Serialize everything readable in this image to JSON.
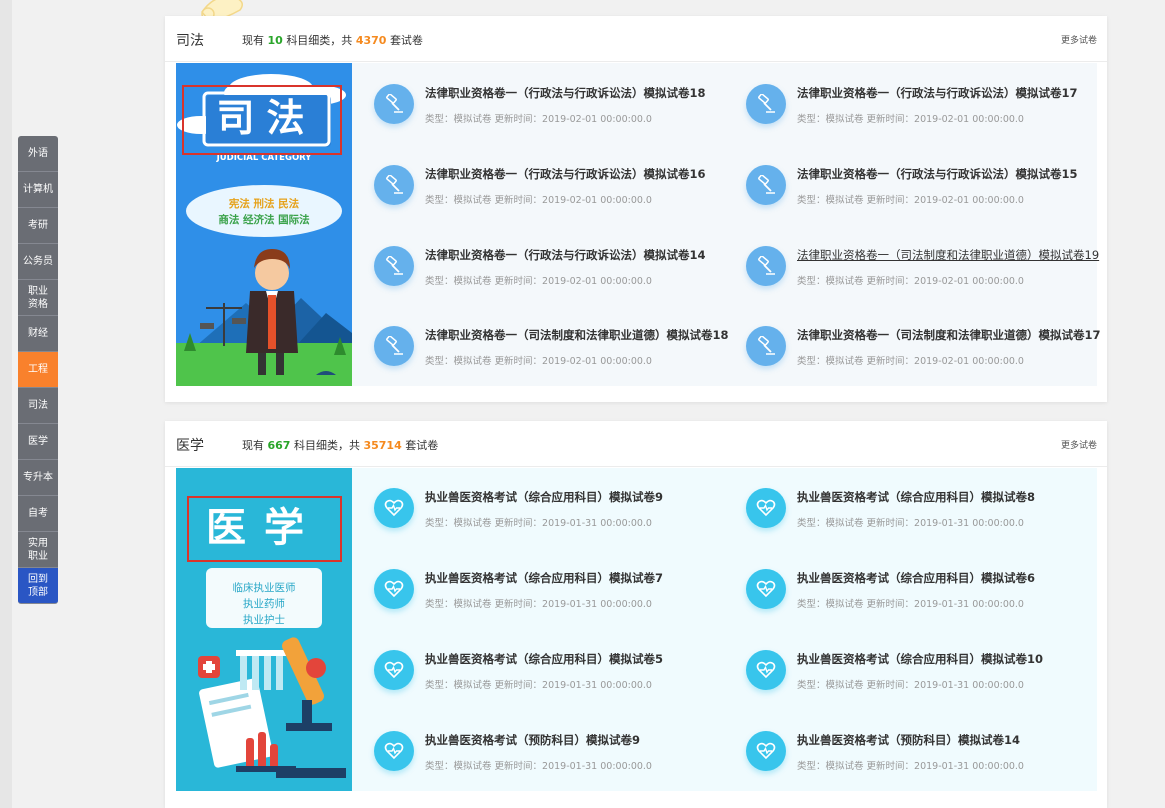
{
  "sidenav": [
    {
      "label": "外语"
    },
    {
      "label": "计算机"
    },
    {
      "label": "考研"
    },
    {
      "label": "公务员"
    },
    {
      "label": "职业资格"
    },
    {
      "label": "财经"
    },
    {
      "label": "工程"
    },
    {
      "label": "司法"
    },
    {
      "label": "医学"
    },
    {
      "label": "专升本"
    },
    {
      "label": "自考"
    },
    {
      "label": "实用职业"
    },
    {
      "label": "回到顶部"
    }
  ],
  "sections": [
    {
      "title": "司法",
      "stats": {
        "prefix": "现有",
        "subjects": "10",
        "mid": "科目细类，共",
        "papers": "4370",
        "suffix": "套试卷"
      },
      "more": "更多试卷",
      "banner": {
        "title": "司法",
        "subtitle": "JUDICIAL CATEGORY",
        "line1": "宪法  刑法  民法",
        "line2": "商法 经济法 国际法"
      },
      "papers": [
        {
          "title": "法律职业资格卷一（行政法与行政诉讼法）模拟试卷18",
          "meta": "类型：模拟试卷 更新时间：2019-02-01 00:00:00.0"
        },
        {
          "title": "法律职业资格卷一（行政法与行政诉讼法）模拟试卷17",
          "meta": "类型：模拟试卷 更新时间：2019-02-01 00:00:00.0"
        },
        {
          "title": "法律职业资格卷一（行政法与行政诉讼法）模拟试卷16",
          "meta": "类型：模拟试卷 更新时间：2019-02-01 00:00:00.0"
        },
        {
          "title": "法律职业资格卷一（行政法与行政诉讼法）模拟试卷15",
          "meta": "类型：模拟试卷 更新时间：2019-02-01 00:00:00.0"
        },
        {
          "title": "法律职业资格卷一（行政法与行政诉讼法）模拟试卷14",
          "meta": "类型：模拟试卷 更新时间：2019-02-01 00:00:00.0"
        },
        {
          "title": "法律职业资格卷一（司法制度和法律职业道德）模拟试卷19",
          "meta": "类型：模拟试卷 更新时间：2019-02-01 00:00:00.0"
        },
        {
          "title": "法律职业资格卷一（司法制度和法律职业道德）模拟试卷18",
          "meta": "类型：模拟试卷 更新时间：2019-02-01 00:00:00.0"
        },
        {
          "title": "法律职业资格卷一（司法制度和法律职业道德）模拟试卷17",
          "meta": "类型：模拟试卷 更新时间：2019-02-01 00:00:00.0"
        }
      ]
    },
    {
      "title": "医学",
      "stats": {
        "prefix": "现有",
        "subjects": "667",
        "mid": "科目细类，共",
        "papers": "35714",
        "suffix": "套试卷"
      },
      "more": "更多试卷",
      "banner": {
        "title": "医学",
        "line1": "临床执业医师",
        "line2": "执业药师",
        "line3": "执业护士"
      },
      "papers": [
        {
          "title": "执业兽医资格考试（综合应用科目）模拟试卷9",
          "meta": "类型：模拟试卷 更新时间：2019-01-31 00:00:00.0"
        },
        {
          "title": "执业兽医资格考试（综合应用科目）模拟试卷8",
          "meta": "类型：模拟试卷 更新时间：2019-01-31 00:00:00.0"
        },
        {
          "title": "执业兽医资格考试（综合应用科目）模拟试卷7",
          "meta": "类型：模拟试卷 更新时间：2019-01-31 00:00:00.0"
        },
        {
          "title": "执业兽医资格考试（综合应用科目）模拟试卷6",
          "meta": "类型：模拟试卷 更新时间：2019-01-31 00:00:00.0"
        },
        {
          "title": "执业兽医资格考试（综合应用科目）模拟试卷5",
          "meta": "类型：模拟试卷 更新时间：2019-01-31 00:00:00.0"
        },
        {
          "title": "执业兽医资格考试（综合应用科目）模拟试卷10",
          "meta": "类型：模拟试卷 更新时间：2019-01-31 00:00:00.0"
        },
        {
          "title": "执业兽医资格考试（预防科目）模拟试卷9",
          "meta": "类型：模拟试卷 更新时间：2019-01-31 00:00:00.0"
        },
        {
          "title": "执业兽医资格考试（预防科目）模拟试卷14",
          "meta": "类型：模拟试卷 更新时间：2019-01-31 00:00:00.0"
        }
      ]
    }
  ]
}
